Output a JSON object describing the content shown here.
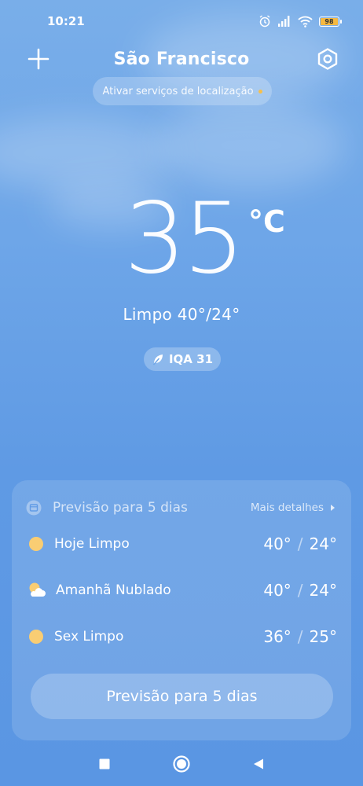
{
  "status_bar": {
    "time": "10:21",
    "battery": "98",
    "icons": [
      "alarm-icon",
      "signal-icon",
      "wifi-icon",
      "battery-icon"
    ]
  },
  "header": {
    "city": "São Francisco",
    "location_prompt": "Ativar serviços de localização",
    "add_icon": "plus-icon",
    "settings_icon": "settings-hexagon-icon"
  },
  "current": {
    "temperature": "35",
    "unit": "°C",
    "condition_line": "Limpo  40°/24°",
    "aqi_label": "IQA 31"
  },
  "forecast": {
    "title": "Previsão para 5 dias",
    "more_details": "Mais detalhes",
    "days": [
      {
        "label": "Hoje  Limpo",
        "high": "40°",
        "low": "24°",
        "icon": "sun-icon"
      },
      {
        "label": "Amanhã  Nublado",
        "high": "40°",
        "low": "24°",
        "icon": "partly-cloudy-icon"
      },
      {
        "label": "Sex  Limpo",
        "high": "36°",
        "low": "25°",
        "icon": "sun-icon"
      }
    ],
    "button_label": "Previsão para 5 dias"
  },
  "nav": [
    "recents-square-icon",
    "home-circle-icon",
    "back-triangle-icon"
  ],
  "colors": {
    "sun": "#f9cd73",
    "accent_dot": "#f7c04a"
  }
}
